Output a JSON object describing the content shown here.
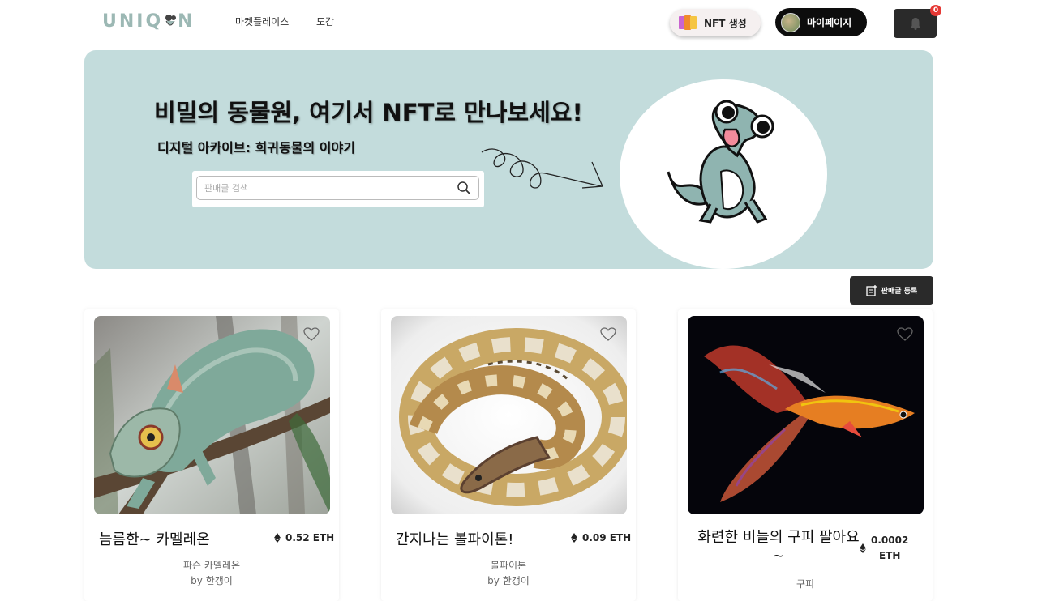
{
  "nav": {
    "logo": "UNIQ N",
    "links": [
      "마켓플레이스",
      "도감"
    ],
    "create_label": "NFT 생성",
    "mypage_label": "마이페이지",
    "notification_count": "0"
  },
  "hero": {
    "title": "비밀의 동물원, 여기서 NFT로 만나보세요!",
    "subtitle": "디지털 아카이브: 희귀동물의 이야기",
    "search_placeholder": "판매글 검색"
  },
  "register_label": "판매글 등록",
  "cards": [
    {
      "title": "늠름한~ 카멜레온",
      "price": "0.52 ETH",
      "species": "파슨 카멜레온",
      "creator": "by 한갱이"
    },
    {
      "title": "간지나는 볼파이톤!",
      "price": "0.09 ETH",
      "species": "볼파이톤",
      "creator": "by 한갱이"
    },
    {
      "title": "화련한 비늘의 구피 팔아요~",
      "price_value": "0.0002",
      "price_unit": "ETH",
      "species": "구피",
      "creator": ""
    }
  ],
  "colors": {
    "hero_bg": "#c3dcdc",
    "logo": "#9cb8b4",
    "dark_button": "#2a2a2a",
    "badge": "#e53935"
  },
  "icons": [
    "search-icon",
    "bell-icon",
    "heart-icon",
    "ethereum-icon",
    "register-icon",
    "cards-icon"
  ]
}
